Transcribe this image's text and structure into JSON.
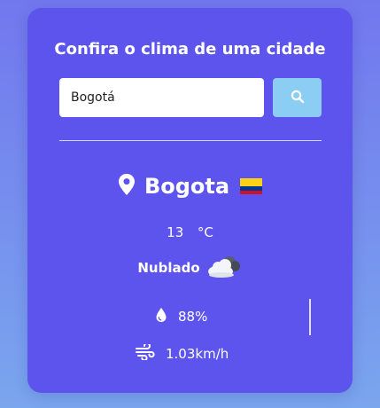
{
  "header": {
    "title": "Confira o clima de uma cidade"
  },
  "search": {
    "value": "Bogotá",
    "placeholder": "",
    "button_icon": "search-icon"
  },
  "weather": {
    "city": "Bogota",
    "location_icon": "map-pin-icon",
    "flag_icon": "colombia-flag-icon",
    "temperature": "13",
    "unit": "°C",
    "condition": "Nublado",
    "condition_icon": "cloudy-night-icon",
    "humidity": "88%",
    "humidity_icon": "water-drop-icon",
    "wind": "1.03km/h",
    "wind_icon": "wind-icon"
  },
  "colors": {
    "card": "#5c54ed",
    "button": "#8ccdf4",
    "background_top": "#7277ee",
    "background_bottom": "#7aa6ee"
  }
}
